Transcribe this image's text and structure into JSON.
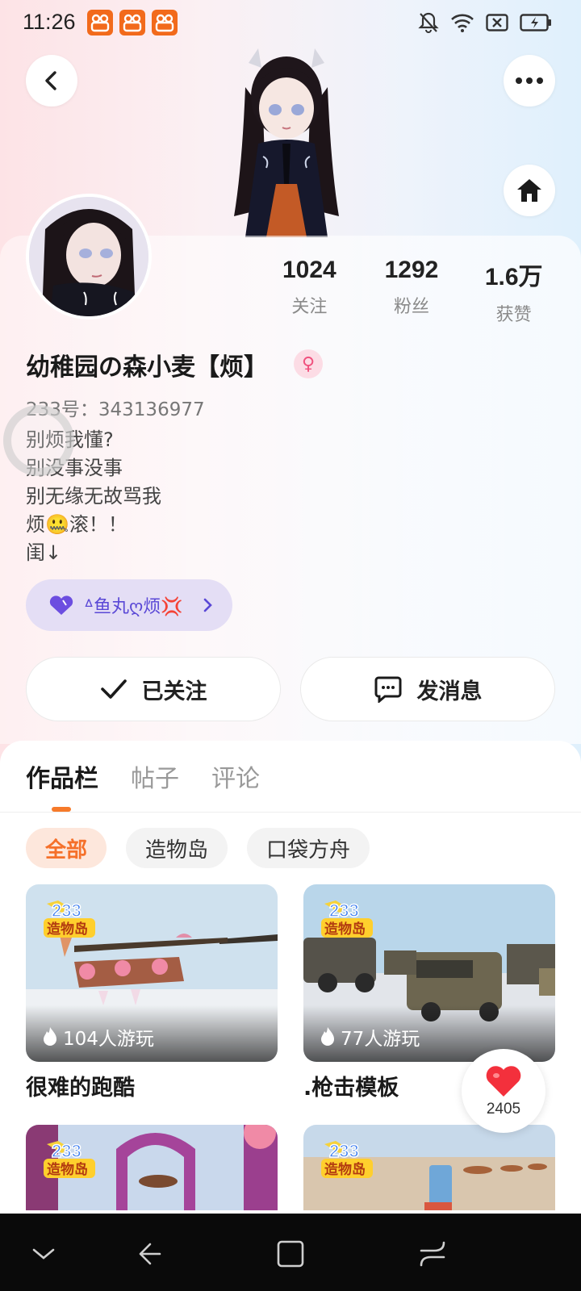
{
  "status_bar": {
    "time": "11:26"
  },
  "stats": [
    {
      "value": "1024",
      "label": "关注"
    },
    {
      "value": "1292",
      "label": "粉丝"
    },
    {
      "value": "1.6万",
      "label": "获赞"
    }
  ],
  "profile": {
    "nickname": "幼稚园の森小麦【烦】",
    "uid": "233号：343136977",
    "bio": [
      "别烦我懂?",
      "别没事没事",
      "别无缘无故骂我",
      "烦🤐滚！！",
      "闺↓"
    ],
    "group_label": "ᐞ鱼丸ღ烦💢",
    "gender_symbol": "♀"
  },
  "actions": {
    "follow": "已关注",
    "message": "发消息"
  },
  "tabs": [
    "作品栏",
    "帖子",
    "评论"
  ],
  "filters": [
    "全部",
    "造物岛",
    "口袋方舟"
  ],
  "games": [
    {
      "title": "很难的跑酷",
      "players": "104人游玩"
    },
    {
      "title": ".枪击模板",
      "players": "77人游玩"
    }
  ],
  "logo_text": {
    "line1": "233",
    "line2": "造物岛"
  },
  "like_count": "2405",
  "colors": {
    "accent": "#f67a2a",
    "group_purple": "#5a48d6",
    "like_red": "#f3303c"
  }
}
